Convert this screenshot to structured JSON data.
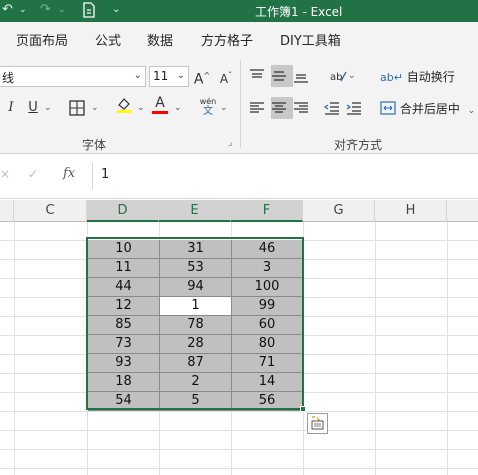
{
  "titlebar": {
    "title": "工作簿1  -  Excel",
    "bg_color": "#217346",
    "quick_access": [
      {
        "name": "undo-icon",
        "glyph": "↶"
      },
      {
        "name": "redo-icon",
        "glyph": "↷"
      },
      {
        "name": "document-icon",
        "glyph": "🗎"
      },
      {
        "name": "customize-icon",
        "glyph": "⌄"
      }
    ]
  },
  "tabs": [
    "页面布局",
    "公式",
    "数据",
    "方方格子",
    "DIY工具箱"
  ],
  "ribbon": {
    "font_group_label": "字体",
    "align_group_label": "对齐方式",
    "font_name_partial": "线",
    "font_size": "11",
    "grow_font": "A^",
    "shrink_font": "Aˇ",
    "italic": "I",
    "underline": "U",
    "wrap_text": "自动换行",
    "merge_center": "合并后居中",
    "font_color": "#ff0000",
    "highlight_color": "#ffff00"
  },
  "formula_bar": {
    "value": "1",
    "fx": "fx"
  },
  "columns": [
    "C",
    "D",
    "E",
    "F",
    "G",
    "H"
  ],
  "selected_columns": [
    "D",
    "E",
    "F"
  ],
  "table": [
    [
      "10",
      "31",
      "46"
    ],
    [
      "11",
      "53",
      "3"
    ],
    [
      "44",
      "94",
      "100"
    ],
    [
      "12",
      "1",
      "99"
    ],
    [
      "85",
      "78",
      "60"
    ],
    [
      "73",
      "28",
      "80"
    ],
    [
      "93",
      "87",
      "71"
    ],
    [
      "18",
      "2",
      "14"
    ],
    [
      "54",
      "5",
      "56"
    ]
  ],
  "active_cell": {
    "row": 3,
    "col": 1
  }
}
